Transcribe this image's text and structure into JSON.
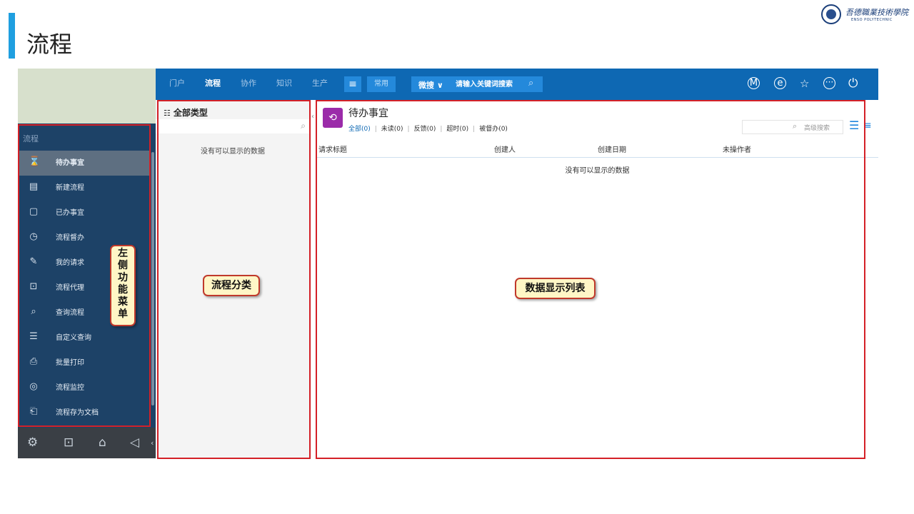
{
  "slide": {
    "title": "流程",
    "logo_text": "吾德職業技術學院",
    "logo_subtext": "ENSO POLYTECHNIC"
  },
  "topnav": {
    "tabs": [
      {
        "label": "门户",
        "active": false
      },
      {
        "label": "流程",
        "active": true
      },
      {
        "label": "协作",
        "active": false
      },
      {
        "label": "知识",
        "active": false
      },
      {
        "label": "生产",
        "active": false
      }
    ],
    "menu_icon": "menu-icon",
    "common_label": "常用",
    "search_scope": "微搜 ∨",
    "search_placeholder": "请输入关键词搜索",
    "right_icons": [
      "m-circle-icon",
      "e-circle-icon",
      "star-icon",
      "more-circle-icon",
      "power-icon"
    ]
  },
  "sidebar": {
    "section_label": "流程",
    "items": [
      {
        "label": "待办事宜",
        "icon": "hourglass-icon",
        "active": true
      },
      {
        "label": "新建流程",
        "icon": "new-document-icon",
        "active": false
      },
      {
        "label": "已办事宜",
        "icon": "done-document-icon",
        "active": false
      },
      {
        "label": "流程督办",
        "icon": "clock-icon",
        "active": false
      },
      {
        "label": "我的请求",
        "icon": "edit-icon",
        "active": false
      },
      {
        "label": "流程代理",
        "icon": "proxy-icon",
        "active": false
      },
      {
        "label": "查询流程",
        "icon": "search-icon",
        "active": false
      },
      {
        "label": "自定义查询",
        "icon": "list-document-icon",
        "active": false
      },
      {
        "label": "批量打印",
        "icon": "printer-icon",
        "active": false
      },
      {
        "label": "流程监控",
        "icon": "monitor-icon",
        "active": false
      },
      {
        "label": "流程存为文档",
        "icon": "save-document-icon",
        "active": false
      }
    ],
    "bottom_icons": [
      "settings-icon",
      "lock-icon",
      "shirt-icon",
      "speaker-icon"
    ]
  },
  "category_panel": {
    "title": "全部类型",
    "empty_text": "没有可以显示的数据"
  },
  "main_panel": {
    "title": "待办事宜",
    "filters": [
      {
        "label": "全部(0)",
        "active": true
      },
      {
        "label": "未读(0)",
        "active": false
      },
      {
        "label": "反馈(0)",
        "active": false
      },
      {
        "label": "超时(0)",
        "active": false
      },
      {
        "label": "被督办(0)",
        "active": false
      }
    ],
    "advanced_search_label": "高级搜索",
    "columns": [
      "请求标题",
      "创建人",
      "创建日期",
      "未操作者"
    ],
    "empty_text": "没有可以显示的数据"
  },
  "annotations": {
    "left_menu": "左侧功能菜单",
    "category": "流程分类",
    "data_list": "数据显示列表"
  },
  "colors": {
    "accent_bar": "#1f9fe0",
    "nav_bg": "#0e68b3",
    "sidebar_bg": "#1d4267",
    "annotation_red": "#d42027",
    "callout_bg": "#fff6c6",
    "todo_icon_bg": "#9b2ba9"
  }
}
